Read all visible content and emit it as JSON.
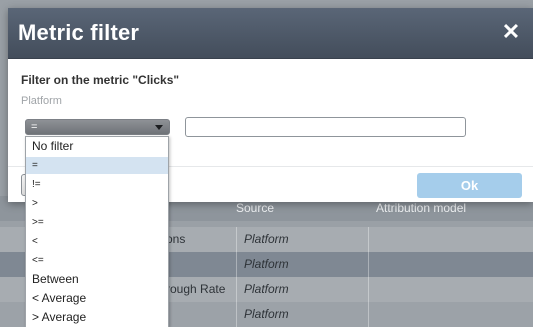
{
  "modal": {
    "title": "Metric filter",
    "close_glyph": "✕",
    "filter_heading": "Filter on the metric \"Clicks\"",
    "subheading": "Platform",
    "operator_select": {
      "value": "="
    },
    "value_input": {
      "value": "",
      "placeholder": ""
    },
    "ok_label": "Ok",
    "cancel_label": ""
  },
  "dropdown": {
    "selected_index": 1,
    "options": [
      "No filter",
      "=",
      "!=",
      ">",
      ">=",
      "<",
      "<=",
      "Between",
      "< Average",
      "> Average"
    ]
  },
  "background_table": {
    "header": {
      "col2": "Source",
      "col3": "Attribution model"
    },
    "rows": [
      {
        "name": "ons",
        "source": "Platform"
      },
      {
        "name": "",
        "source": "Platform"
      },
      {
        "name": "rough Rate",
        "source": "Platform"
      },
      {
        "name": "",
        "source": "Platform"
      }
    ]
  },
  "colors": {
    "header_bg": "#4f5a69",
    "ok_button": "#a5cdeb",
    "selected_option": "#d4e3f1",
    "backdrop": "#9aa0a6"
  },
  "icons": {
    "close": "close-icon",
    "dropdown": "chevron-down-icon"
  }
}
